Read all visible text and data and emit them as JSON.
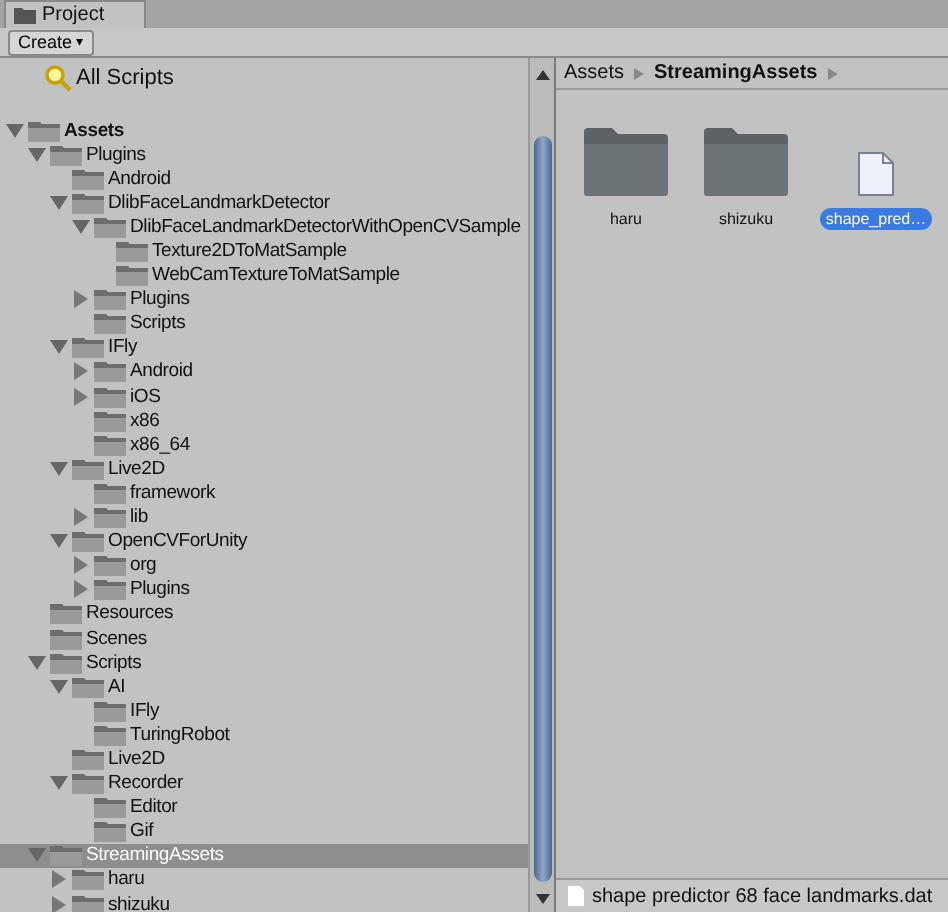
{
  "tab": {
    "label": "Project",
    "selected": true
  },
  "toolbar": {
    "create_button": "Create",
    "caret": "▾"
  },
  "favorites": [
    {
      "label": "All Scripts",
      "selected": false
    }
  ],
  "tree": [
    {
      "label": "Assets",
      "selected": false,
      "expanded": true,
      "children": [
        {
          "label": "Plugins",
          "selected": false,
          "expanded": true,
          "children": [
            {
              "label": "Android",
              "selected": false
            },
            {
              "label": "DlibFaceLandmarkDetector",
              "selected": false,
              "expanded": true,
              "children": [
                {
                  "label": "DlibFaceLandmarkDetectorWithOpenCVSample",
                  "selected": false,
                  "expanded": true,
                  "children": [
                    {
                      "label": "Texture2DToMatSample",
                      "selected": false
                    },
                    {
                      "label": "WebCamTextureToMatSample",
                      "selected": false
                    }
                  ]
                },
                {
                  "label": "Plugins",
                  "selected": false,
                  "expanded": false
                },
                {
                  "label": "Scripts",
                  "selected": false
                }
              ]
            },
            {
              "label": "IFly",
              "selected": false,
              "expanded": true,
              "children": [
                {
                  "label": "Android",
                  "selected": false,
                  "expanded": false
                },
                {
                  "label": "iOS",
                  "selected": false,
                  "expanded": false
                },
                {
                  "label": "x86",
                  "selected": false
                },
                {
                  "label": "x86_64",
                  "selected": false
                }
              ]
            },
            {
              "label": "Live2D",
              "selected": false,
              "expanded": true,
              "children": [
                {
                  "label": "framework",
                  "selected": false
                },
                {
                  "label": "lib",
                  "selected": false,
                  "expanded": false
                }
              ]
            },
            {
              "label": "OpenCVForUnity",
              "selected": false,
              "expanded": true,
              "children": [
                {
                  "label": "org",
                  "selected": false,
                  "expanded": false
                },
                {
                  "label": "Plugins",
                  "selected": false,
                  "expanded": false
                }
              ]
            }
          ]
        },
        {
          "label": "Resources",
          "selected": false
        },
        {
          "label": "Scenes",
          "selected": false
        },
        {
          "label": "Scripts",
          "selected": false,
          "expanded": true,
          "children": [
            {
              "label": "AI",
              "selected": false,
              "expanded": true,
              "children": [
                {
                  "label": "IFly",
                  "selected": false
                },
                {
                  "label": "TuringRobot",
                  "selected": false
                }
              ]
            },
            {
              "label": "Live2D",
              "selected": false
            },
            {
              "label": "Recorder",
              "selected": false,
              "expanded": true,
              "children": [
                {
                  "label": "Editor",
                  "selected": false
                },
                {
                  "label": "Gif",
                  "selected": false
                }
              ]
            }
          ]
        },
        {
          "label": "StreamingAssets",
          "selected": true,
          "expanded": true,
          "children": [
            {
              "label": "haru",
              "selected": false,
              "expanded": false
            },
            {
              "label": "shizuku",
              "selected": false,
              "expanded": false
            }
          ]
        }
      ]
    }
  ],
  "breadcrumb": [
    {
      "label": "Assets",
      "current": false
    },
    {
      "label": "StreamingAssets",
      "current": true
    }
  ],
  "assets": [
    {
      "kind": "folder",
      "label": "haru",
      "selected": false
    },
    {
      "kind": "folder",
      "label": "shizuku",
      "selected": false
    },
    {
      "kind": "file",
      "label": "shape_pred…",
      "selected": true
    }
  ],
  "status_bar": {
    "path": "shape predictor 68 face landmarks.dat"
  }
}
